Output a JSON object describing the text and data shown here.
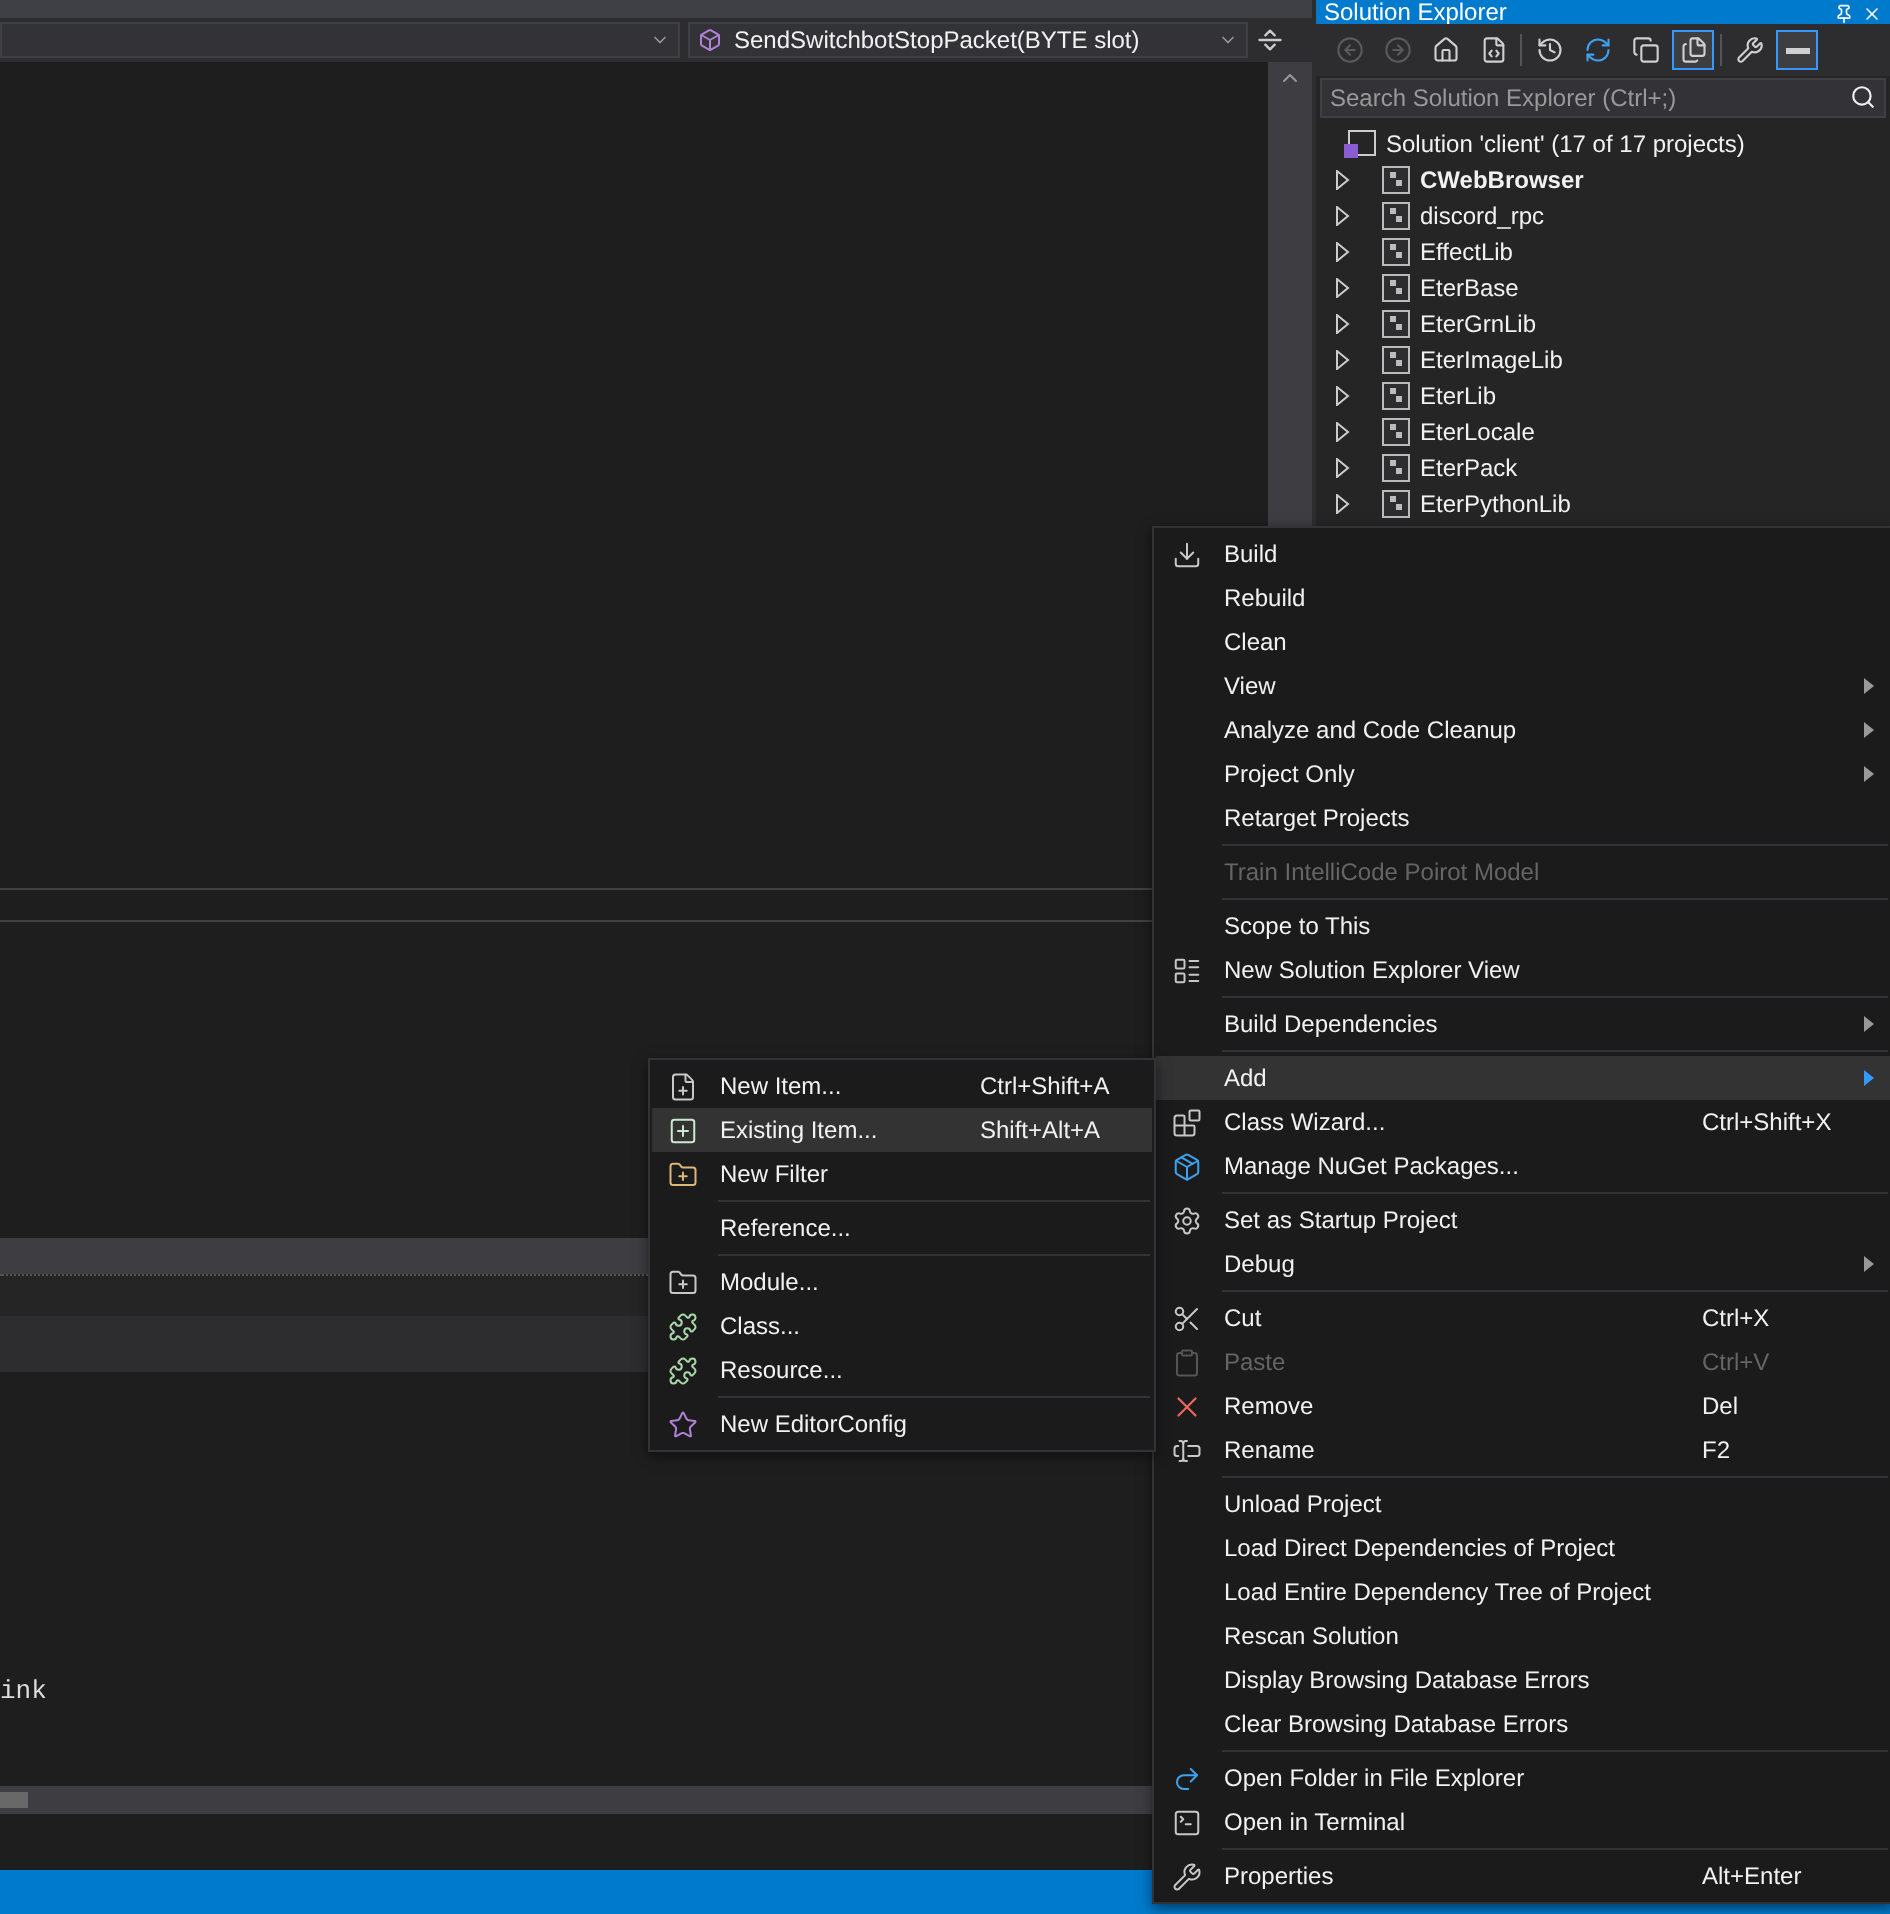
{
  "editor": {
    "navigation_bar": {
      "member": "SendSwitchbotStopPacket(BYTE slot)"
    },
    "output_text": "ink"
  },
  "solution_explorer": {
    "title": "Solution Explorer",
    "toolbar": [
      {
        "disabled": true,
        "pressed": false
      },
      {
        "disabled": true,
        "pressed": false
      },
      {
        "disabled": false,
        "pressed": false
      },
      {
        "disabled": false,
        "pressed": false
      },
      {
        "disabled": false,
        "pressed": false
      },
      {
        "disabled": false,
        "pressed": false
      },
      {
        "disabled": false,
        "pressed": false
      },
      {
        "disabled": false,
        "pressed": true
      },
      {
        "disabled": false,
        "pressed": false
      },
      {
        "disabled": false,
        "pressed": true
      }
    ],
    "search": {
      "placeholder": "Search Solution Explorer (Ctrl+;)"
    },
    "solution": "Solution 'client' (17 of 17 projects)",
    "projects": [
      {
        "name": "CWebBrowser",
        "startup": true
      },
      {
        "name": "discord_rpc",
        "startup": false
      },
      {
        "name": "EffectLib",
        "startup": false
      },
      {
        "name": "EterBase",
        "startup": false
      },
      {
        "name": "EterGrnLib",
        "startup": false
      },
      {
        "name": "EterImageLib",
        "startup": false
      },
      {
        "name": "EterLib",
        "startup": false
      },
      {
        "name": "EterLocale",
        "startup": false
      },
      {
        "name": "EterPack",
        "startup": false
      },
      {
        "name": "EterPythonLib",
        "startup": false
      }
    ]
  },
  "context_menu": {
    "items": [
      {
        "kind": "command",
        "label": "Build",
        "selected": false,
        "disabled": false,
        "submenu": false
      },
      {
        "kind": "command",
        "label": "Rebuild",
        "selected": false,
        "disabled": false,
        "submenu": false
      },
      {
        "kind": "command",
        "label": "Clean",
        "selected": false,
        "disabled": false,
        "submenu": false
      },
      {
        "kind": "command",
        "label": "View",
        "selected": false,
        "disabled": false,
        "submenu": true
      },
      {
        "kind": "command",
        "label": "Analyze and Code Cleanup",
        "selected": false,
        "disabled": false,
        "submenu": true
      },
      {
        "kind": "command",
        "label": "Project Only",
        "selected": false,
        "disabled": false,
        "submenu": true
      },
      {
        "kind": "command",
        "label": "Retarget Projects",
        "selected": false,
        "disabled": false,
        "submenu": false
      },
      {
        "kind": "separator"
      },
      {
        "kind": "command",
        "label": "Train IntelliCode Poirot Model",
        "selected": false,
        "disabled": true,
        "submenu": false
      },
      {
        "kind": "separator"
      },
      {
        "kind": "command",
        "label": "Scope to This",
        "selected": false,
        "disabled": false,
        "submenu": false
      },
      {
        "kind": "command",
        "label": "New Solution Explorer View",
        "selected": false,
        "disabled": false,
        "submenu": false
      },
      {
        "kind": "separator"
      },
      {
        "kind": "command",
        "label": "Build Dependencies",
        "selected": false,
        "disabled": false,
        "submenu": true
      },
      {
        "kind": "separator"
      },
      {
        "kind": "command",
        "label": "Add",
        "selected": true,
        "disabled": false,
        "submenu": true
      },
      {
        "kind": "command",
        "label": "Class Wizard...",
        "shortcut": "Ctrl+Shift+X",
        "selected": false,
        "disabled": false,
        "submenu": false
      },
      {
        "kind": "command",
        "label": "Manage NuGet Packages...",
        "selected": false,
        "disabled": false,
        "submenu": false
      },
      {
        "kind": "separator"
      },
      {
        "kind": "command",
        "label": "Set as Startup Project",
        "selected": false,
        "disabled": false,
        "submenu": false
      },
      {
        "kind": "command",
        "label": "Debug",
        "selected": false,
        "disabled": false,
        "submenu": true
      },
      {
        "kind": "separator"
      },
      {
        "kind": "command",
        "label": "Cut",
        "shortcut": "Ctrl+X",
        "selected": false,
        "disabled": false,
        "submenu": false
      },
      {
        "kind": "command",
        "label": "Paste",
        "shortcut": "Ctrl+V",
        "selected": false,
        "disabled": true,
        "submenu": false
      },
      {
        "kind": "command",
        "label": "Remove",
        "shortcut": "Del",
        "selected": false,
        "disabled": false,
        "submenu": false
      },
      {
        "kind": "command",
        "label": "Rename",
        "shortcut": "F2",
        "selected": false,
        "disabled": false,
        "submenu": false
      },
      {
        "kind": "separator"
      },
      {
        "kind": "command",
        "label": "Unload Project",
        "selected": false,
        "disabled": false,
        "submenu": false
      },
      {
        "kind": "command",
        "label": "Load Direct Dependencies of Project",
        "selected": false,
        "disabled": false,
        "submenu": false
      },
      {
        "kind": "command",
        "label": "Load Entire Dependency Tree of Project",
        "selected": false,
        "disabled": false,
        "submenu": false
      },
      {
        "kind": "command",
        "label": "Rescan Solution",
        "selected": false,
        "disabled": false,
        "submenu": false
      },
      {
        "kind": "command",
        "label": "Display Browsing Database Errors",
        "selected": false,
        "disabled": false,
        "submenu": false
      },
      {
        "kind": "command",
        "label": "Clear Browsing Database Errors",
        "selected": false,
        "disabled": false,
        "submenu": false
      },
      {
        "kind": "separator"
      },
      {
        "kind": "command",
        "label": "Open Folder in File Explorer",
        "selected": false,
        "disabled": false,
        "submenu": false
      },
      {
        "kind": "command",
        "label": "Open in Terminal",
        "selected": false,
        "disabled": false,
        "submenu": false
      },
      {
        "kind": "separator"
      },
      {
        "kind": "command",
        "label": "Properties",
        "shortcut": "Alt+Enter",
        "selected": false,
        "disabled": false,
        "submenu": false
      }
    ]
  },
  "add_submenu": {
    "items": [
      {
        "kind": "command",
        "label": "New Item...",
        "shortcut": "Ctrl+Shift+A",
        "selected": false,
        "disabled": false
      },
      {
        "kind": "command",
        "label": "Existing Item...",
        "shortcut": "Shift+Alt+A",
        "selected": true,
        "disabled": false
      },
      {
        "kind": "command",
        "label": "New Filter",
        "selected": false,
        "disabled": false
      },
      {
        "kind": "separator"
      },
      {
        "kind": "command",
        "label": "Reference...",
        "selected": false,
        "disabled": false
      },
      {
        "kind": "separator"
      },
      {
        "kind": "command",
        "label": "Module...",
        "selected": false,
        "disabled": false
      },
      {
        "kind": "command",
        "label": "Class...",
        "selected": false,
        "disabled": false
      },
      {
        "kind": "command",
        "label": "Resource...",
        "selected": false,
        "disabled": false
      },
      {
        "kind": "separator"
      },
      {
        "kind": "command",
        "label": "New EditorConfig",
        "selected": false,
        "disabled": false
      }
    ]
  }
}
